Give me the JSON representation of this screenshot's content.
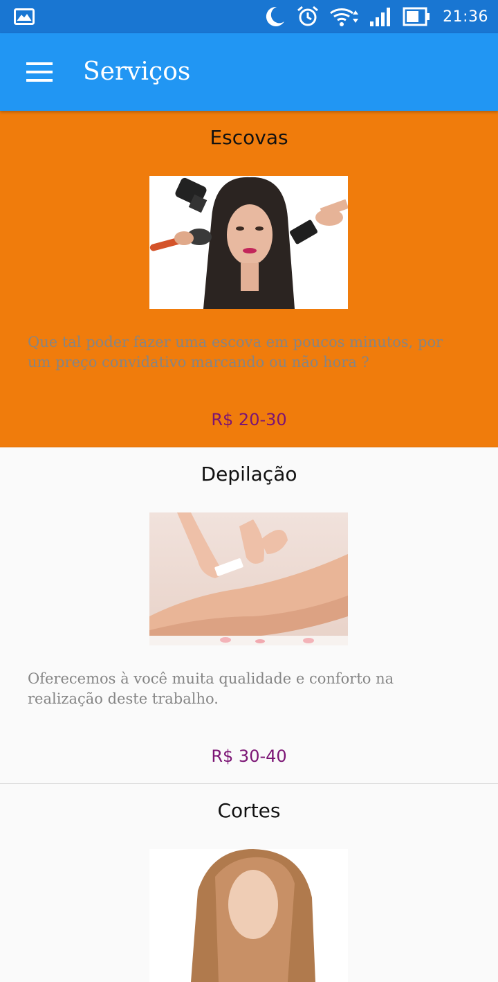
{
  "status_bar": {
    "time": "21:36",
    "icons": [
      "gallery-icon",
      "moon-icon",
      "alarm-icon",
      "wifi-icon",
      "signal-icon",
      "battery-icon"
    ],
    "background": "#1976d2"
  },
  "toolbar": {
    "title": "Serviços",
    "menu_icon": "hamburger-menu-icon",
    "background": "#2196f3"
  },
  "services": [
    {
      "title": "Escovas",
      "image": "hair-blowdry-photo",
      "description": "Que tal poder fazer uma escova em poucos minutos, por um preço convidativo marcando ou não hora ?",
      "price": "R$ 20-30",
      "background": "#f07c0c"
    },
    {
      "title": "Depilação",
      "image": "leg-waxing-photo",
      "description": "Oferecemos à você muita qualidade e conforto na realização deste trabalho.",
      "price": "R$ 30-40",
      "background": "#fafafa"
    },
    {
      "title": "Cortes",
      "image": "haircut-photo",
      "background": "#fafafa"
    }
  ],
  "colors": {
    "price": "#7b1474",
    "description": "#858585",
    "highlight_card": "#f07c0c"
  }
}
